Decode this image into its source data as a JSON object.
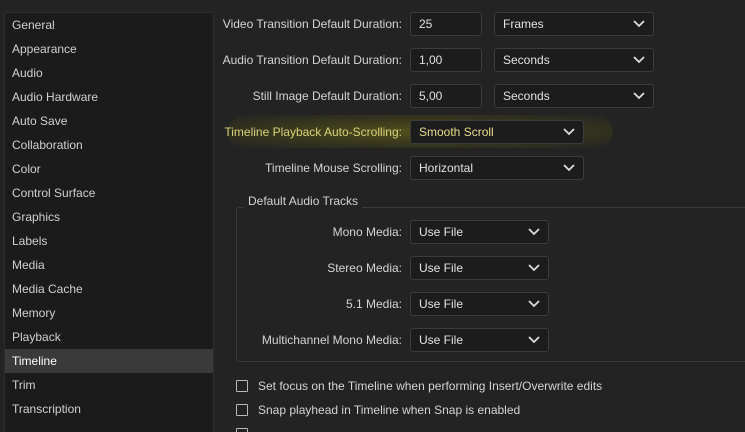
{
  "sidebar": {
    "items": [
      {
        "label": "General"
      },
      {
        "label": "Appearance"
      },
      {
        "label": "Audio"
      },
      {
        "label": "Audio Hardware"
      },
      {
        "label": "Auto Save"
      },
      {
        "label": "Collaboration"
      },
      {
        "label": "Color"
      },
      {
        "label": "Control Surface"
      },
      {
        "label": "Graphics"
      },
      {
        "label": "Labels"
      },
      {
        "label": "Media"
      },
      {
        "label": "Media Cache"
      },
      {
        "label": "Memory"
      },
      {
        "label": "Playback"
      },
      {
        "label": "Timeline"
      },
      {
        "label": "Trim"
      },
      {
        "label": "Transcription"
      }
    ],
    "selected": "Timeline"
  },
  "settings": {
    "video_transition": {
      "label": "Video Transition Default Duration:",
      "value": "25",
      "unit": "Frames"
    },
    "audio_transition": {
      "label": "Audio Transition Default Duration:",
      "value": "1,00",
      "unit": "Seconds"
    },
    "still_image": {
      "label": "Still Image Default Duration:",
      "value": "5,00",
      "unit": "Seconds"
    },
    "auto_scroll": {
      "label": "Timeline Playback Auto-Scrolling:",
      "value": "Smooth Scroll"
    },
    "mouse_scroll": {
      "label": "Timeline Mouse Scrolling:",
      "value": "Horizontal"
    }
  },
  "audio_tracks": {
    "title": "Default Audio Tracks",
    "mono": {
      "label": "Mono Media:",
      "value": "Use File"
    },
    "stereo": {
      "label": "Stereo Media:",
      "value": "Use File"
    },
    "five_one": {
      "label": "5.1 Media:",
      "value": "Use File"
    },
    "multichannel": {
      "label": "Multichannel Mono Media:",
      "value": "Use File"
    }
  },
  "checkboxes": {
    "focus_timeline": {
      "label": "Set focus on the Timeline when performing Insert/Overwrite edits",
      "checked": false
    },
    "snap_playhead": {
      "label": "Snap playhead in Timeline when Snap is enabled",
      "checked": false
    }
  },
  "colors": {
    "highlight_text": "#d9d27a",
    "panel_bg": "#232323",
    "sidebar_bg": "#1b1b1b"
  }
}
